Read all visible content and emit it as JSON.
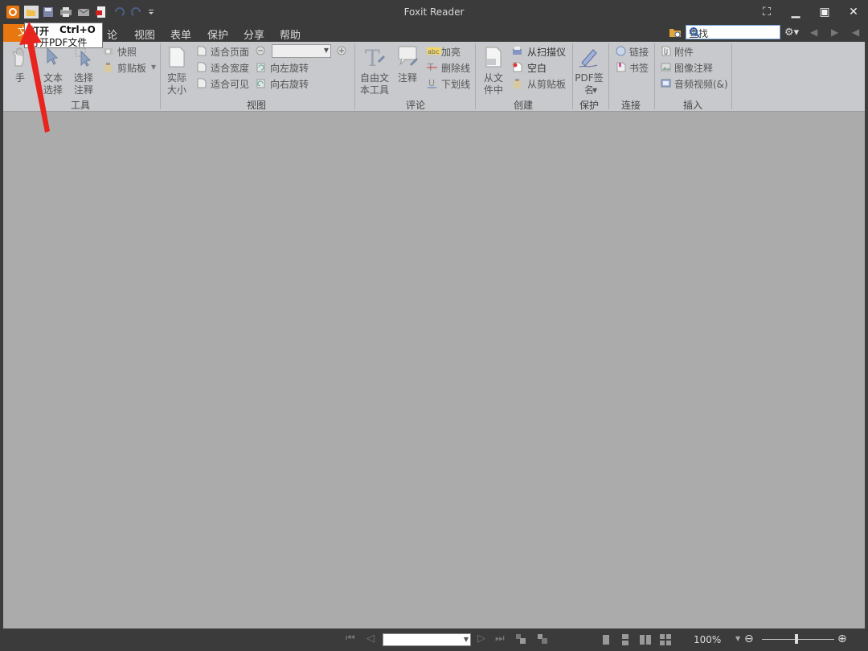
{
  "window": {
    "title": "Foxit Reader"
  },
  "menu": {
    "file": "文",
    "comment_partial": "论",
    "view": "视图",
    "form": "表单",
    "protect": "保护",
    "share": "分享",
    "help": "帮助"
  },
  "search": {
    "value": "查找"
  },
  "tooltip": {
    "name": "打开",
    "shortcut": "Ctrl+O",
    "desc": "打开PDF文件"
  },
  "ribbon": {
    "tools": {
      "hand": "手",
      "text_select": "文本\n选择",
      "select_annot": "选择\n注释",
      "snapshot": "快照",
      "clipboard": "剪贴板",
      "label": "工具"
    },
    "view": {
      "actual_size": "实际\n大小",
      "fit_page": "适合页面",
      "fit_width": "适合宽度",
      "fit_visible": "适合可见",
      "rotate_left": "向左旋转",
      "rotate_right": "向右旋转",
      "label": "视图"
    },
    "comment": {
      "typewriter": "自由文\n本工具",
      "note": "注释",
      "highlight": "加亮",
      "strikeout": "删除线",
      "underline": "下划线",
      "label": "评论"
    },
    "create": {
      "from_file": "从文\n件中",
      "from_scanner": "从扫描仪",
      "blank": "空白",
      "from_clipboard": "从剪贴板",
      "label": "创建"
    },
    "protect": {
      "pdf_sign": "PDF签\n名",
      "label": "保护"
    },
    "links": {
      "link": "链接",
      "bookmark": "书签",
      "label": "连接"
    },
    "insert": {
      "attachment": "附件",
      "image_annot": "图像注释",
      "audio_video": "音频视频(&)",
      "label": "插入"
    }
  },
  "status": {
    "zoom": "100%"
  },
  "colors": {
    "accent": "#e8770f",
    "arrow": "#e8241e"
  }
}
